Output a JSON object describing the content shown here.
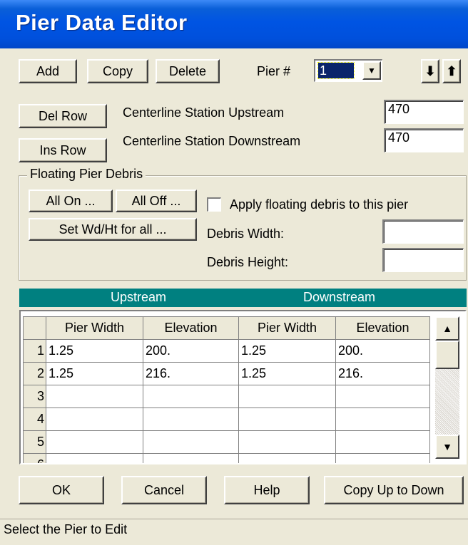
{
  "window": {
    "title": "Pier Data Editor"
  },
  "toolbar": {
    "add_label": "Add",
    "copy_label": "Copy",
    "delete_label": "Delete",
    "pier_label": "Pier #",
    "pier_value": "1",
    "down_arrow": "⬇",
    "up_arrow": "⬆"
  },
  "rows_buttons": {
    "del_row": "Del Row",
    "ins_row": "Ins Row"
  },
  "centerline": {
    "upstream_label": "Centerline Station Upstream",
    "upstream_value": "470",
    "downstream_label": "Centerline Station Downstream",
    "downstream_value": "470"
  },
  "debris": {
    "group_label": "Floating Pier Debris",
    "all_on": "All On ...",
    "all_off": "All Off ...",
    "set_wd_ht": "Set Wd/Ht for all ...",
    "apply_label": "Apply floating debris to this pier",
    "apply_checked": false,
    "width_label": "Debris Width:",
    "width_value": "",
    "height_label": "Debris Height:",
    "height_value": ""
  },
  "table": {
    "upstream_header": "Upstream",
    "downstream_header": "Downstream",
    "columns": [
      "Pier Width",
      "Elevation",
      "Pier Width",
      "Elevation"
    ],
    "rows": [
      {
        "n": "1",
        "cells": [
          "1.25",
          "200.",
          "1.25",
          "200."
        ]
      },
      {
        "n": "2",
        "cells": [
          "1.25",
          "216.",
          "1.25",
          "216."
        ]
      },
      {
        "n": "3",
        "cells": [
          "",
          "",
          "",
          ""
        ]
      },
      {
        "n": "4",
        "cells": [
          "",
          "",
          "",
          ""
        ]
      },
      {
        "n": "5",
        "cells": [
          "",
          "",
          "",
          ""
        ]
      },
      {
        "n": "6",
        "cells": [
          "",
          "",
          "",
          ""
        ]
      }
    ]
  },
  "footer": {
    "ok": "OK",
    "cancel": "Cancel",
    "help": "Help",
    "copy_up_down": "Copy Up to Down"
  },
  "status": "Select the Pier to Edit"
}
